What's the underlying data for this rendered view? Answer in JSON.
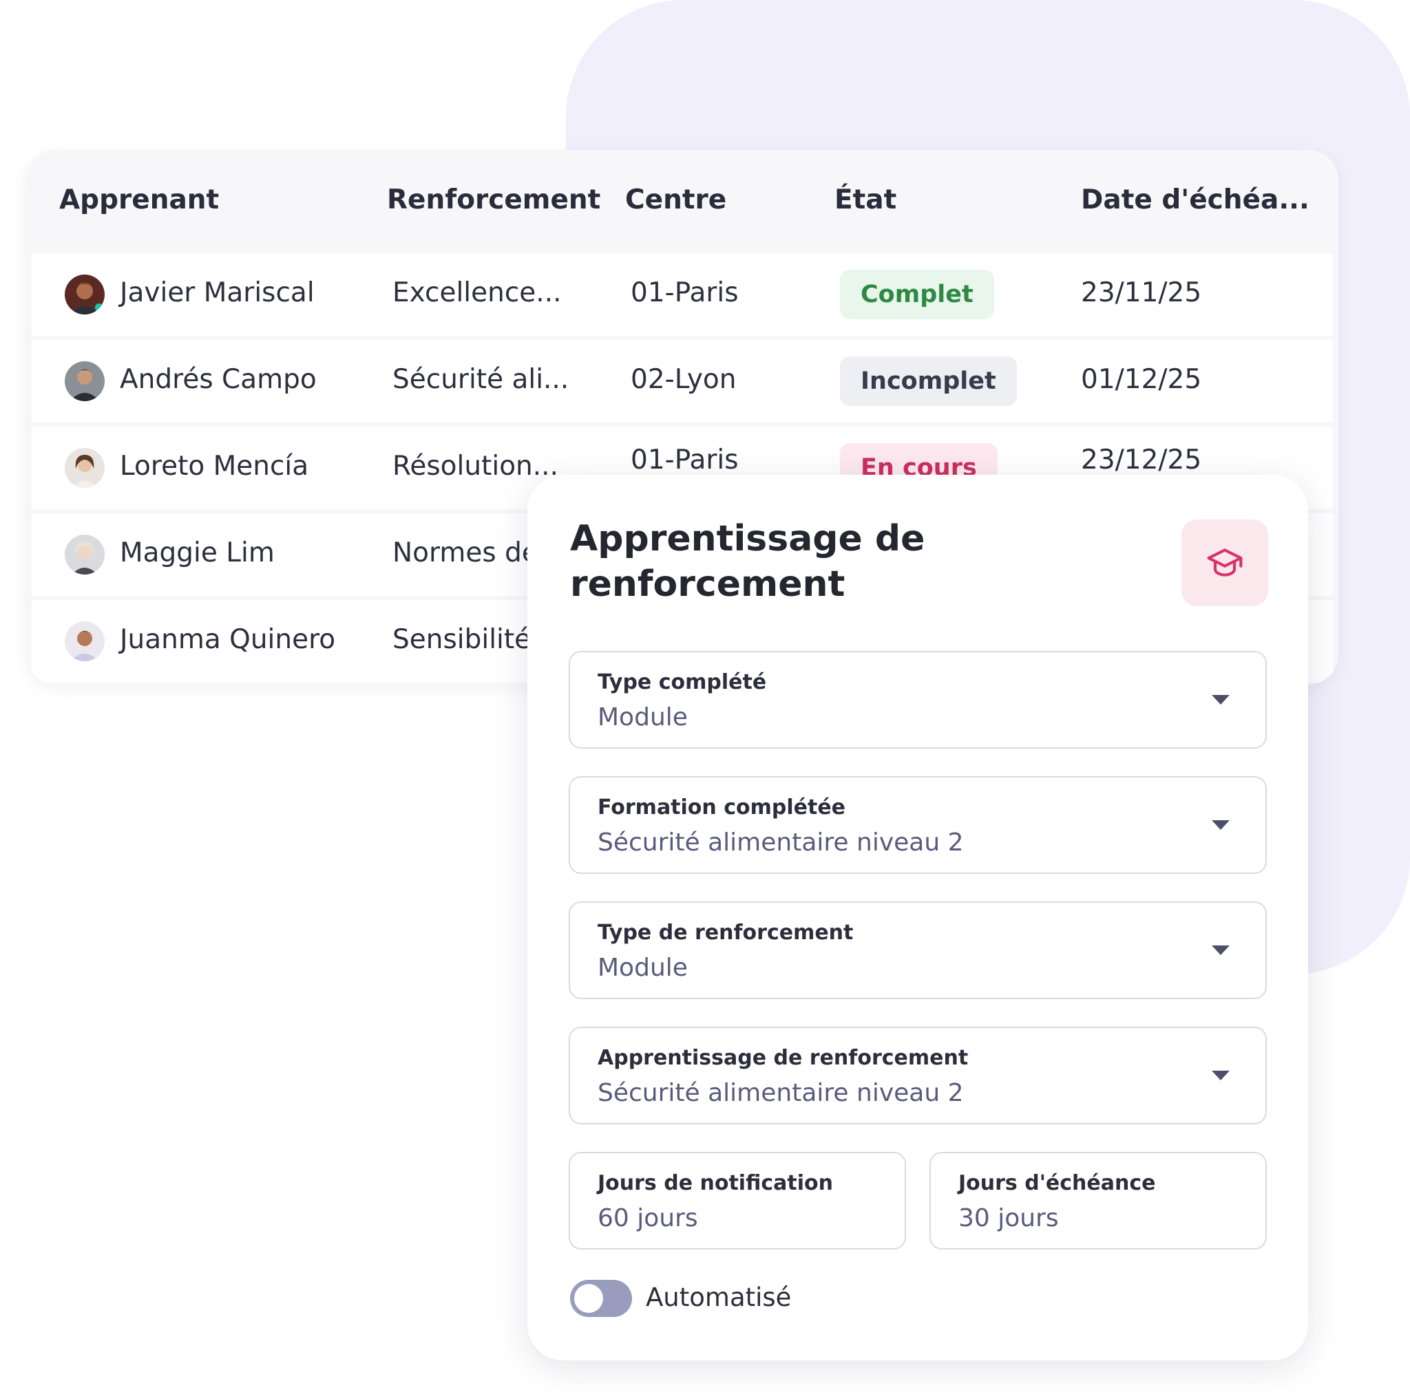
{
  "table": {
    "columns": [
      "Apprenant",
      "Renforcement",
      "Centre",
      "État",
      "Date d'échéa..."
    ],
    "rows": [
      {
        "name": "Javier Mariscal",
        "reinforcement": "Excellence...",
        "center": "01-Paris",
        "status": "Complet",
        "due": "23/11/25"
      },
      {
        "name": "Andrés Campo",
        "reinforcement": "Sécurité ali...",
        "center": "02-Lyon",
        "status": "Incomplet",
        "due": "01/12/25"
      },
      {
        "name": "Loreto Mencía",
        "reinforcement": "Résolution...",
        "center": "01-Paris",
        "status": "En cours",
        "due": "23/12/25"
      },
      {
        "name": "Maggie Lim",
        "reinforcement": "Normes de"
      },
      {
        "name": "Juanma Quinero",
        "reinforcement": "Sensibilité"
      }
    ]
  },
  "status_colors": {
    "complet": {
      "bg": "#e9f6ec",
      "fg": "#2e8a43"
    },
    "incomplet": {
      "bg": "#eeeff3",
      "fg": "#3a3b4a"
    },
    "en_cours": {
      "bg": "#fce8ee",
      "fg": "#cc2f5d"
    }
  },
  "panel": {
    "title": "Apprentissage de renforcement",
    "icon": "graduation-cap-icon",
    "fields": {
      "completed_type": {
        "label": "Type complété",
        "value": "Module"
      },
      "completed_training": {
        "label": "Formation complétée",
        "value": "Sécurité alimentaire niveau 2"
      },
      "reinforcement_type": {
        "label": "Type de renforcement",
        "value": "Module"
      },
      "reinforcement_learning": {
        "label": "Apprentissage de renforcement",
        "value": "Sécurité alimentaire niveau 2"
      },
      "notification_days": {
        "label": "Jours de notification",
        "value": "60 jours"
      },
      "due_days": {
        "label": "Jours d'échéance",
        "value": "30 jours"
      }
    },
    "automated": {
      "label": "Automatisé",
      "enabled": false
    }
  },
  "colors": {
    "background_blob": "#f2effc",
    "accent_icon": "#d6336c",
    "toggle_off": "#9a9cbe"
  }
}
